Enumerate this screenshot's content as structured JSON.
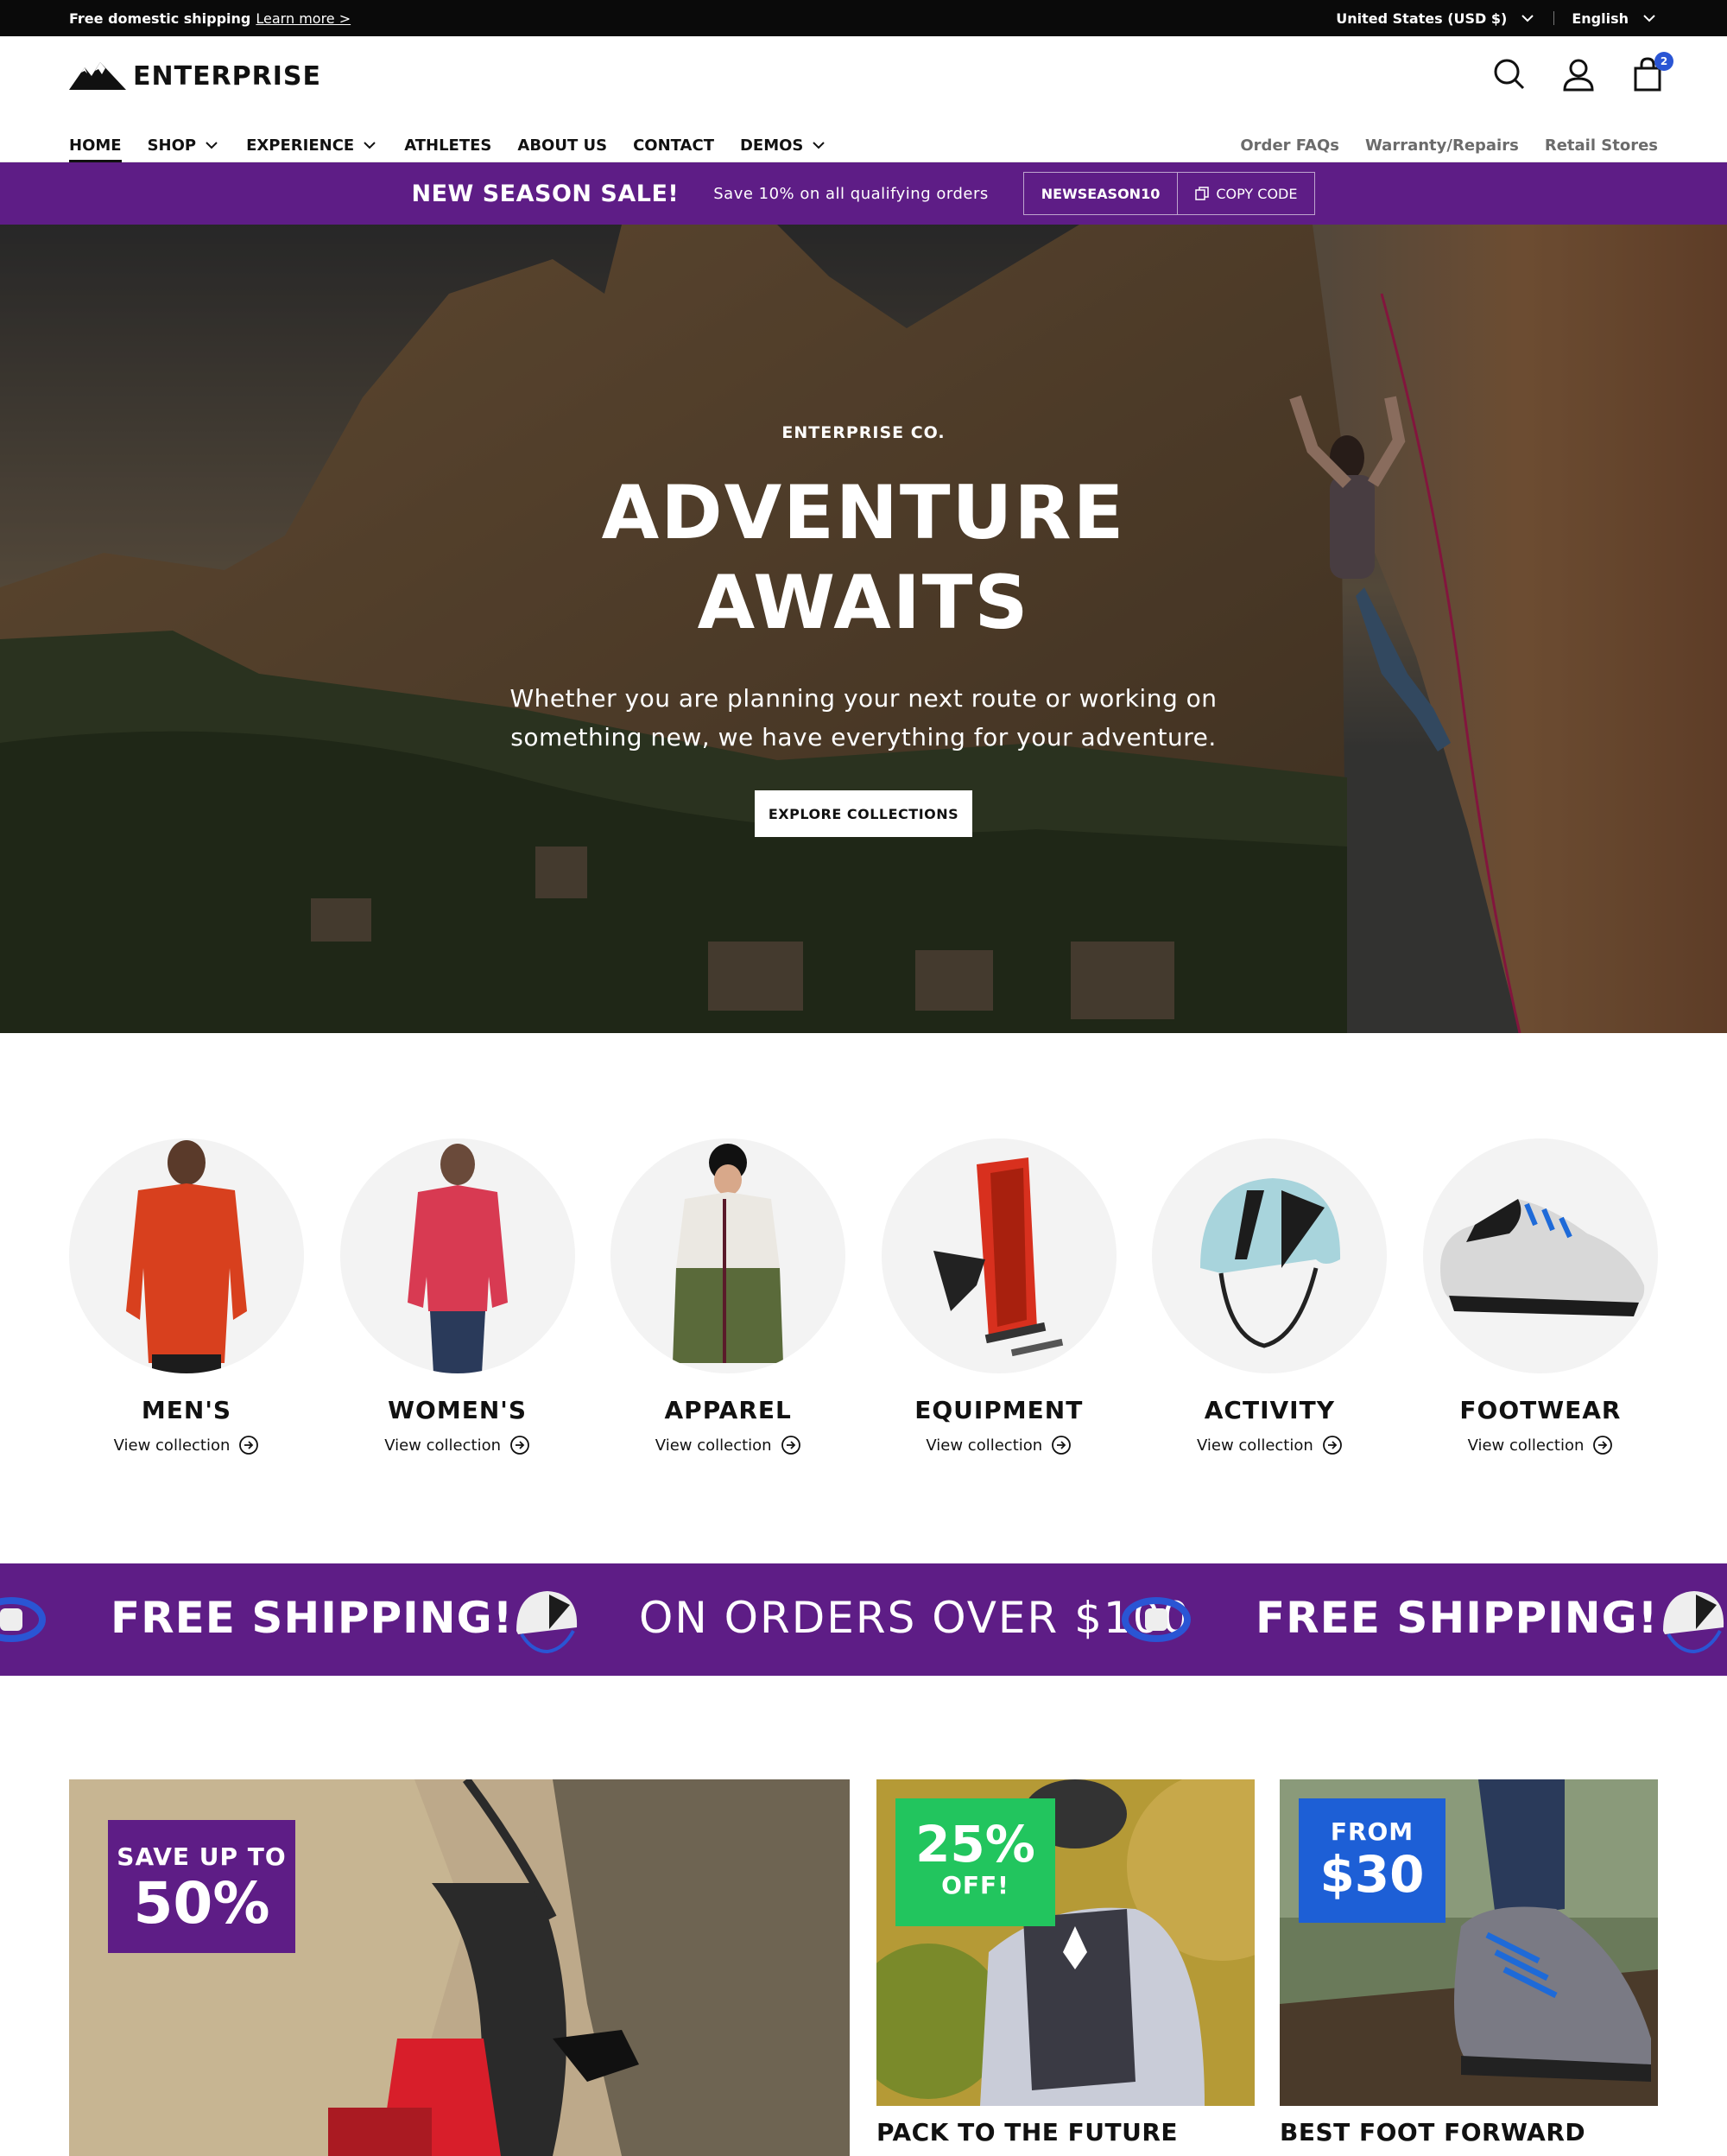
{
  "announcement": {
    "shipping_text": "Free domestic shipping",
    "learn_more": "Learn more >",
    "currency": "United States (USD $)",
    "language": "English"
  },
  "header": {
    "logo_text": "ENTERPRISE",
    "cart_count": "2",
    "nav": [
      {
        "label": "HOME",
        "active": true
      },
      {
        "label": "SHOP",
        "dropdown": true
      },
      {
        "label": "EXPERIENCE",
        "dropdown": true
      },
      {
        "label": "ATHLETES"
      },
      {
        "label": "ABOUT US"
      },
      {
        "label": "CONTACT"
      },
      {
        "label": "DEMOS",
        "dropdown": true
      }
    ],
    "secondary_nav": [
      "Order FAQs",
      "Warranty/Repairs",
      "Retail Stores"
    ]
  },
  "promo_bar": {
    "title": "NEW SEASON SALE!",
    "message": "Save 10% on all qualifying orders",
    "code": "NEWSEASON10",
    "copy_label": "COPY CODE"
  },
  "hero": {
    "kicker": "ENTERPRISE CO.",
    "title_line1": "ADVENTURE",
    "title_line2": "AWAITS",
    "subtitle": "Whether you are planning your next route or working on something new, we have everything for your adventure.",
    "cta": "EXPLORE COLLECTIONS"
  },
  "categories": [
    {
      "name": "MEN'S",
      "link": "View collection"
    },
    {
      "name": "WOMEN'S",
      "link": "View collection"
    },
    {
      "name": "APPAREL",
      "link": "View collection"
    },
    {
      "name": "EQUIPMENT",
      "link": "View collection"
    },
    {
      "name": "ACTIVITY",
      "link": "View collection"
    },
    {
      "name": "FOOTWEAR",
      "link": "View collection"
    }
  ],
  "shipping_strip": {
    "text1": "FREE SHIPPING!",
    "text2": "ON ORDERS OVER $100",
    "text3": "FREE SHIPPING!"
  },
  "promo_cards": [
    {
      "badge_line1": "SAVE UP TO",
      "badge_line2": "50%",
      "badge_color": "#5e1d86"
    },
    {
      "badge_line1": "25%",
      "badge_line2": "OFF!",
      "badge_color": "#22c55e",
      "title": "PACK TO THE FUTURE"
    },
    {
      "badge_line1": "FROM",
      "badge_line2": "$30",
      "badge_color": "#1d5fd6",
      "title": "BEST FOOT FORWARD"
    }
  ],
  "colors": {
    "brand_purple": "#5e1d86",
    "cart_badge": "#2a55d4",
    "dark": "#0a0a0a"
  }
}
